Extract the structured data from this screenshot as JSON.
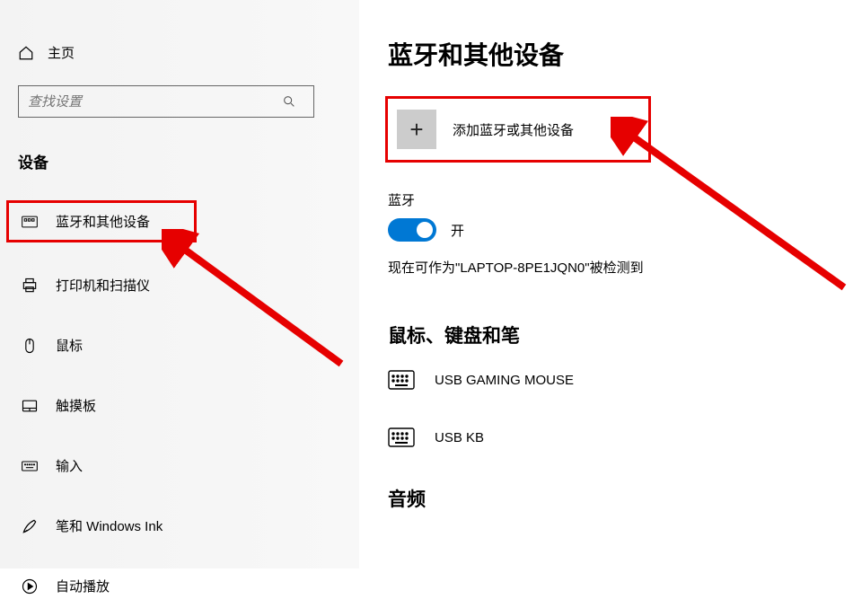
{
  "sidebar": {
    "home": "主页",
    "search_placeholder": "查找设置",
    "heading": "设备",
    "items": [
      {
        "label": "蓝牙和其他设备"
      },
      {
        "label": "打印机和扫描仪"
      },
      {
        "label": "鼠标"
      },
      {
        "label": "触摸板"
      },
      {
        "label": "输入"
      },
      {
        "label": "笔和 Windows Ink"
      },
      {
        "label": "自动播放"
      }
    ]
  },
  "main": {
    "title": "蓝牙和其他设备",
    "add_device": "添加蓝牙或其他设备",
    "bt_label": "蓝牙",
    "bt_state": "开",
    "discoverable": "现在可作为\"LAPTOP-8PE1JQN0\"被检测到",
    "section_mkp": "鼠标、键盘和笔",
    "devices": [
      {
        "name": "USB GAMING MOUSE"
      },
      {
        "name": "USB KB"
      }
    ],
    "section_audio": "音频"
  }
}
